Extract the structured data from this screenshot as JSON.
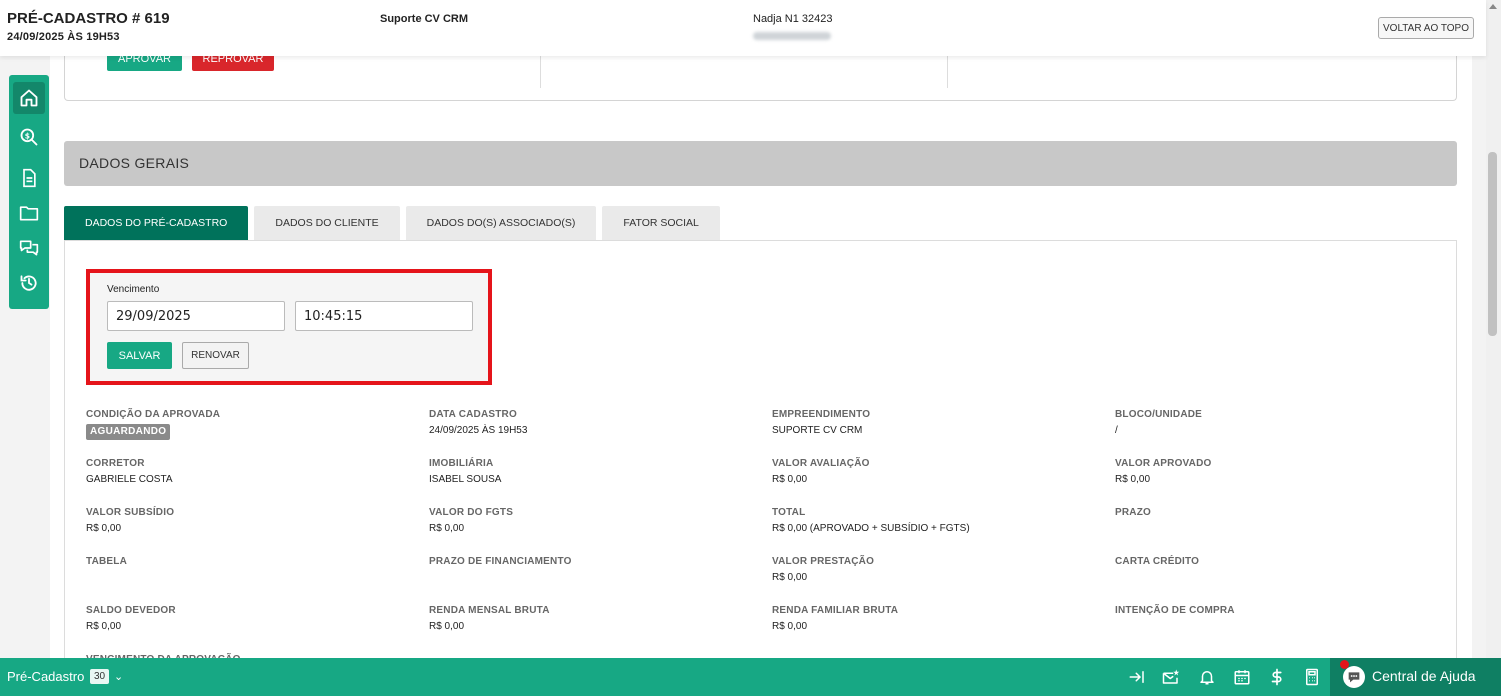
{
  "header": {
    "title": "PRÉ-CADASTRO # 619",
    "date": "24/09/2025 ÀS 19H53",
    "company": "Suporte CV CRM",
    "user": "Nadja N1 32423",
    "back_to_top": "VOLTAR AO TOPO"
  },
  "approval": {
    "approve_label": "APROVAR",
    "reject_label": "REPROVAR"
  },
  "section_title": "DADOS GERAIS",
  "tabs": [
    {
      "label": "DADOS DO PRÉ-CADASTRO",
      "active": true
    },
    {
      "label": "DADOS DO CLIENTE",
      "active": false
    },
    {
      "label": "DADOS DO(S) ASSOCIADO(S)",
      "active": false
    },
    {
      "label": "FATOR SOCIAL",
      "active": false
    }
  ],
  "vencimento": {
    "label": "Vencimento",
    "date_value": "29/09/2025",
    "time_value": "10:45:15",
    "save_label": "SALVAR",
    "renew_label": "RENOVAR"
  },
  "fields": [
    {
      "label": "CONDIÇÃO DA APROVADA",
      "value": "AGUARDANDO",
      "badge": true
    },
    {
      "label": "DATA CADASTRO",
      "value": "24/09/2025 ÀS 19H53"
    },
    {
      "label": "EMPREENDIMENTO",
      "value": "SUPORTE CV CRM"
    },
    {
      "label": "BLOCO/UNIDADE",
      "value": "/"
    },
    {
      "label": "CORRETOR",
      "value": "GABRIELE COSTA"
    },
    {
      "label": "IMOBILIÁRIA",
      "value": "ISABEL SOUSA"
    },
    {
      "label": "VALOR AVALIAÇÃO",
      "value": "R$ 0,00"
    },
    {
      "label": "VALOR APROVADO",
      "value": "R$ 0,00"
    },
    {
      "label": "VALOR SUBSÍDIO",
      "value": "R$ 0,00"
    },
    {
      "label": "VALOR DO FGTS",
      "value": "R$ 0,00"
    },
    {
      "label": "TOTAL",
      "value": "R$ 0,00 (APROVADO + SUBSÍDIO + FGTS)"
    },
    {
      "label": "PRAZO",
      "value": ""
    },
    {
      "label": "TABELA",
      "value": ""
    },
    {
      "label": "PRAZO DE FINANCIAMENTO",
      "value": ""
    },
    {
      "label": "VALOR PRESTAÇÃO",
      "value": "R$ 0,00"
    },
    {
      "label": "CARTA CRÉDITO",
      "value": ""
    },
    {
      "label": "SALDO DEVEDOR",
      "value": "R$ 0,00"
    },
    {
      "label": "RENDA MENSAL BRUTA",
      "value": "R$ 0,00"
    },
    {
      "label": "RENDA FAMILIAR BRUTA",
      "value": "R$ 0,00"
    },
    {
      "label": "INTENÇÃO DE COMPRA",
      "value": ""
    },
    {
      "label": "VENCIMENTO DA APROVAÇÃO",
      "value": ""
    }
  ],
  "sidebar": {
    "icons": [
      "home-icon",
      "search-dollar-icon",
      "document-icon",
      "folder-icon",
      "chat-icon",
      "history-icon"
    ]
  },
  "bottombar": {
    "label": "Pré-Cadastro",
    "count": "30",
    "help_label": "Central de Ajuda",
    "icons": [
      "arrow-to-right-icon",
      "mail-star-icon",
      "bell-icon",
      "calendar-icon",
      "dollar-icon",
      "calculator-icon"
    ]
  },
  "colors": {
    "primary": "#17a884",
    "primary_dark": "#00725b",
    "danger": "#d9262b",
    "highlight": "#e5141a"
  }
}
